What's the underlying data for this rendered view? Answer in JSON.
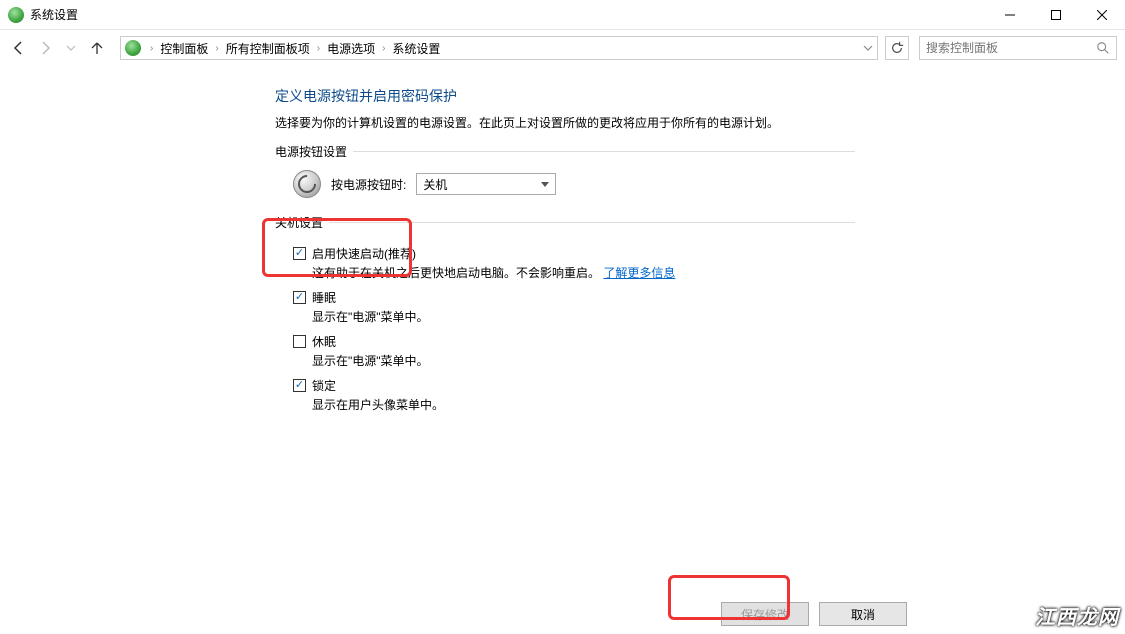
{
  "window": {
    "title": "系统设置"
  },
  "breadcrumb": {
    "items": [
      "控制面板",
      "所有控制面板项",
      "电源选项",
      "系统设置"
    ]
  },
  "search": {
    "placeholder": "搜索控制面板"
  },
  "main": {
    "heading": "定义电源按钮并启用密码保护",
    "subheading": "选择要为你的计算机设置的电源设置。在此页上对设置所做的更改将应用于你所有的电源计划。"
  },
  "power_button_section": {
    "legend": "电源按钮设置",
    "label": "按电源按钮时:",
    "selected": "关机"
  },
  "shutdown_section": {
    "legend": "关机设置",
    "options": [
      {
        "checked": true,
        "label": "启用快速启动(推荐)",
        "desc_prefix": "这有助于在关机之后更快地启动电脑。不会影响重启。",
        "link": "了解更多信息"
      },
      {
        "checked": true,
        "label": "睡眠",
        "desc": "显示在\"电源\"菜单中。"
      },
      {
        "checked": false,
        "label": "休眠",
        "desc": "显示在\"电源\"菜单中。"
      },
      {
        "checked": true,
        "label": "锁定",
        "desc": "显示在用户头像菜单中。"
      }
    ]
  },
  "footer": {
    "save": "保存修改",
    "cancel": "取消"
  },
  "watermark": "江西龙网"
}
